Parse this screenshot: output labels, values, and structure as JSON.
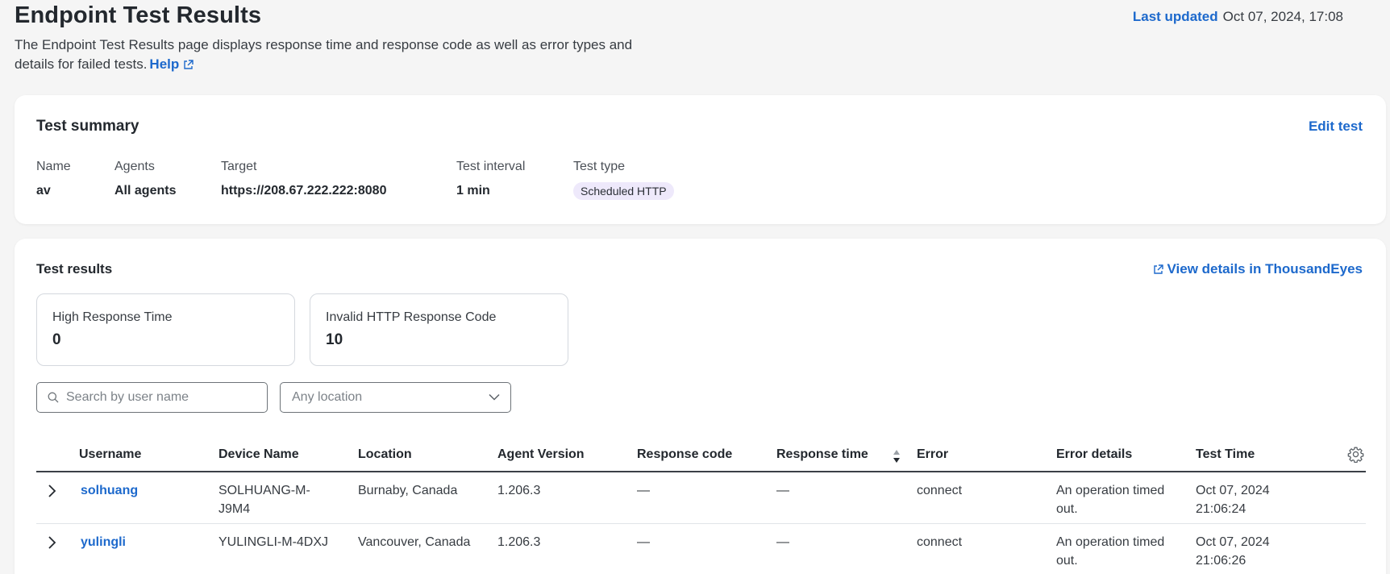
{
  "header": {
    "title": "Endpoint Test Results",
    "description": "The Endpoint Test Results page displays response time and response code as well as error types and details for failed tests.",
    "help_label": "Help",
    "last_updated_label": "Last updated",
    "last_updated_value": "Oct 07, 2024, 17:08"
  },
  "summary": {
    "title": "Test summary",
    "edit_label": "Edit test",
    "fields": [
      {
        "label": "Name",
        "value": "av"
      },
      {
        "label": "Agents",
        "value": "All agents"
      },
      {
        "label": "Target",
        "value": "https://208.67.222.222:8080"
      },
      {
        "label": "Test interval",
        "value": "1 min"
      },
      {
        "label": "Test type",
        "value": "Scheduled HTTP"
      }
    ]
  },
  "results": {
    "title": "Test results",
    "view_details_label": "View details in ThousandEyes",
    "stats": [
      {
        "label": "High Response Time",
        "value": "0"
      },
      {
        "label": "Invalid HTTP Response Code",
        "value": "10"
      }
    ],
    "search_placeholder": "Search by user name",
    "location_placeholder": "Any location",
    "columns": [
      "Username",
      "Device Name",
      "Location",
      "Agent Version",
      "Response code",
      "Response time",
      "Error",
      "Error details",
      "Test Time"
    ],
    "rows": [
      {
        "username": "solhuang",
        "device_l1": "SOLHUANG-M-",
        "device_l2": "J9M4",
        "location": "Burnaby, Canada",
        "agent_version": "1.206.3",
        "response_code": "—",
        "response_time": "—",
        "error": "connect",
        "error_details_l1": "An operation timed",
        "error_details_l2": "out.",
        "test_time_l1": "Oct 07, 2024",
        "test_time_l2": "21:06:24"
      },
      {
        "username": "yulingli",
        "device_l1": "YULINGLI-M-4DXJ",
        "device_l2": "",
        "location": "Vancouver, Canada",
        "agent_version": "1.206.3",
        "response_code": "—",
        "response_time": "—",
        "error": "connect",
        "error_details_l1": "An operation timed",
        "error_details_l2": "out.",
        "test_time_l1": "Oct 07, 2024",
        "test_time_l2": "21:06:26"
      }
    ]
  },
  "colors": {
    "accent": "#1d69cc",
    "badge_bg": "#eee9fb",
    "page_bg": "#f5f5f5"
  },
  "icons": [
    "external-link-icon",
    "search-icon",
    "chevron-down-icon",
    "sort-icon",
    "gear-icon",
    "chevron-right-icon"
  ]
}
